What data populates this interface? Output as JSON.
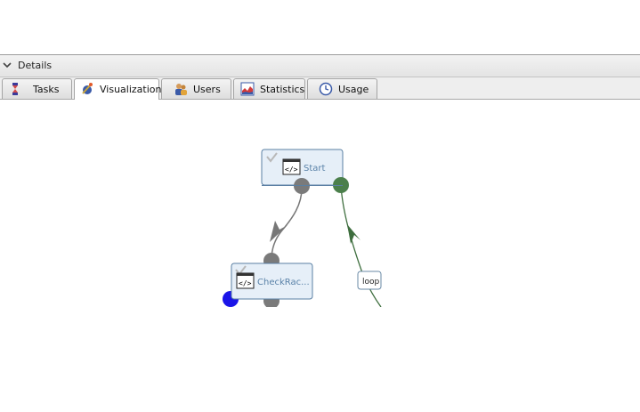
{
  "details": {
    "title": "Details"
  },
  "tabs": [
    {
      "label": "Tasks",
      "icon": "tasks-icon",
      "active": false
    },
    {
      "label": "Visualization",
      "icon": "visualization-icon",
      "active": true
    },
    {
      "label": "Users",
      "icon": "users-icon",
      "active": false
    },
    {
      "label": "Statistics",
      "icon": "statistics-icon",
      "active": false
    },
    {
      "label": "Usage",
      "icon": "usage-icon",
      "active": false
    }
  ],
  "workflow": {
    "nodes": [
      {
        "label": "Start",
        "icon": "script-icon",
        "status_icon": "checkmark-icon"
      },
      {
        "label": "CheckRac...",
        "icon": "script-icon",
        "status_icon": "checkmark-icon"
      }
    ],
    "edges": [
      {
        "label": "loop",
        "color": "#3e6e3e"
      }
    ]
  },
  "colors": {
    "node_fill": "#e6eff8",
    "node_border": "#5a7fa3",
    "port_grey": "#7a7a7a",
    "port_green": "#4b7f4b",
    "port_blue": "#1a14e8",
    "edge_grey": "#777777",
    "edge_green": "#3e6e3e"
  }
}
